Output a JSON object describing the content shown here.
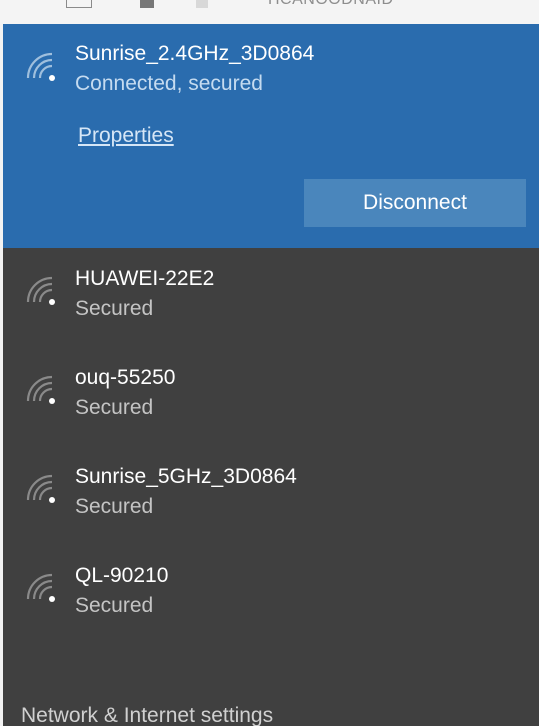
{
  "background": {
    "fragment_text": "HCANOODNAID"
  },
  "connected_network": {
    "name": "Sunrise_2.4GHz_3D0864",
    "status": "Connected, secured",
    "properties_label": "Properties",
    "disconnect_label": "Disconnect",
    "icon": "wifi-icon"
  },
  "networks": [
    {
      "name": "HUAWEI-22E2",
      "status": "Secured",
      "icon": "wifi-icon"
    },
    {
      "name": "ouq-55250",
      "status": "Secured",
      "icon": "wifi-icon"
    },
    {
      "name": "Sunrise_5GHz_3D0864",
      "status": "Secured",
      "icon": "wifi-icon"
    },
    {
      "name": "QL-90210",
      "status": "Secured",
      "icon": "wifi-icon"
    }
  ],
  "footer": {
    "settings_label": "Network & Internet settings"
  },
  "colors": {
    "accent": "#2a6cae",
    "panel": "#404040",
    "button": "#4a86bc"
  }
}
